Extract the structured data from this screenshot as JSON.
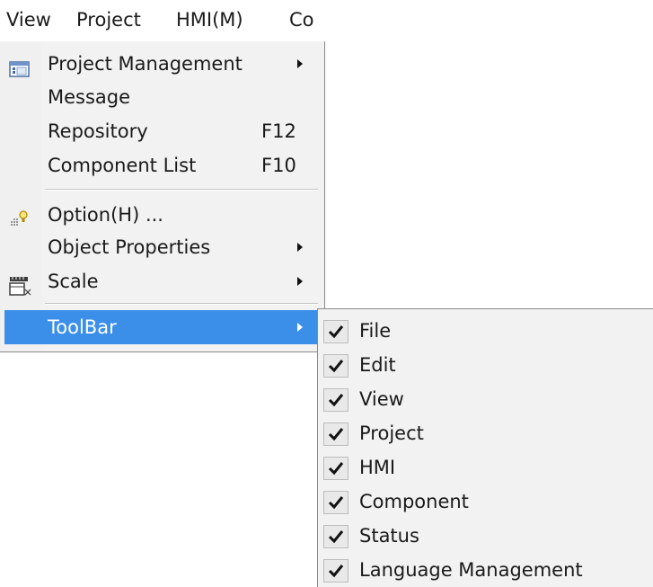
{
  "menubar": {
    "items": [
      {
        "label": "View"
      },
      {
        "label": "Project"
      },
      {
        "label": "HMI(M)"
      },
      {
        "label": "Co"
      }
    ]
  },
  "view_menu": {
    "items": [
      {
        "label": "Project Management",
        "icon": "project-management-icon",
        "submenu": true
      },
      {
        "label": "Message"
      },
      {
        "label": "Repository",
        "shortcut": "F12"
      },
      {
        "label": "Component List",
        "shortcut": "F10"
      },
      {
        "label": "Option(H) ...",
        "icon": "option-icon"
      },
      {
        "label": "Object Properties",
        "submenu": true
      },
      {
        "label": "Scale",
        "icon": "scale-icon",
        "submenu": true
      },
      {
        "label": "ToolBar",
        "submenu": true,
        "highlighted": true
      }
    ]
  },
  "toolbar_submenu": {
    "items": [
      {
        "label": "File",
        "checked": true
      },
      {
        "label": "Edit",
        "checked": true
      },
      {
        "label": "View",
        "checked": true
      },
      {
        "label": "Project",
        "checked": true
      },
      {
        "label": "HMI",
        "checked": true
      },
      {
        "label": "Component",
        "checked": true
      },
      {
        "label": "Status",
        "checked": true
      },
      {
        "label": "Language Management",
        "checked": true
      }
    ]
  },
  "colors": {
    "highlight": "#3b8fe8",
    "menu_background": "#f2f2f2",
    "checkmark": "#111111"
  }
}
